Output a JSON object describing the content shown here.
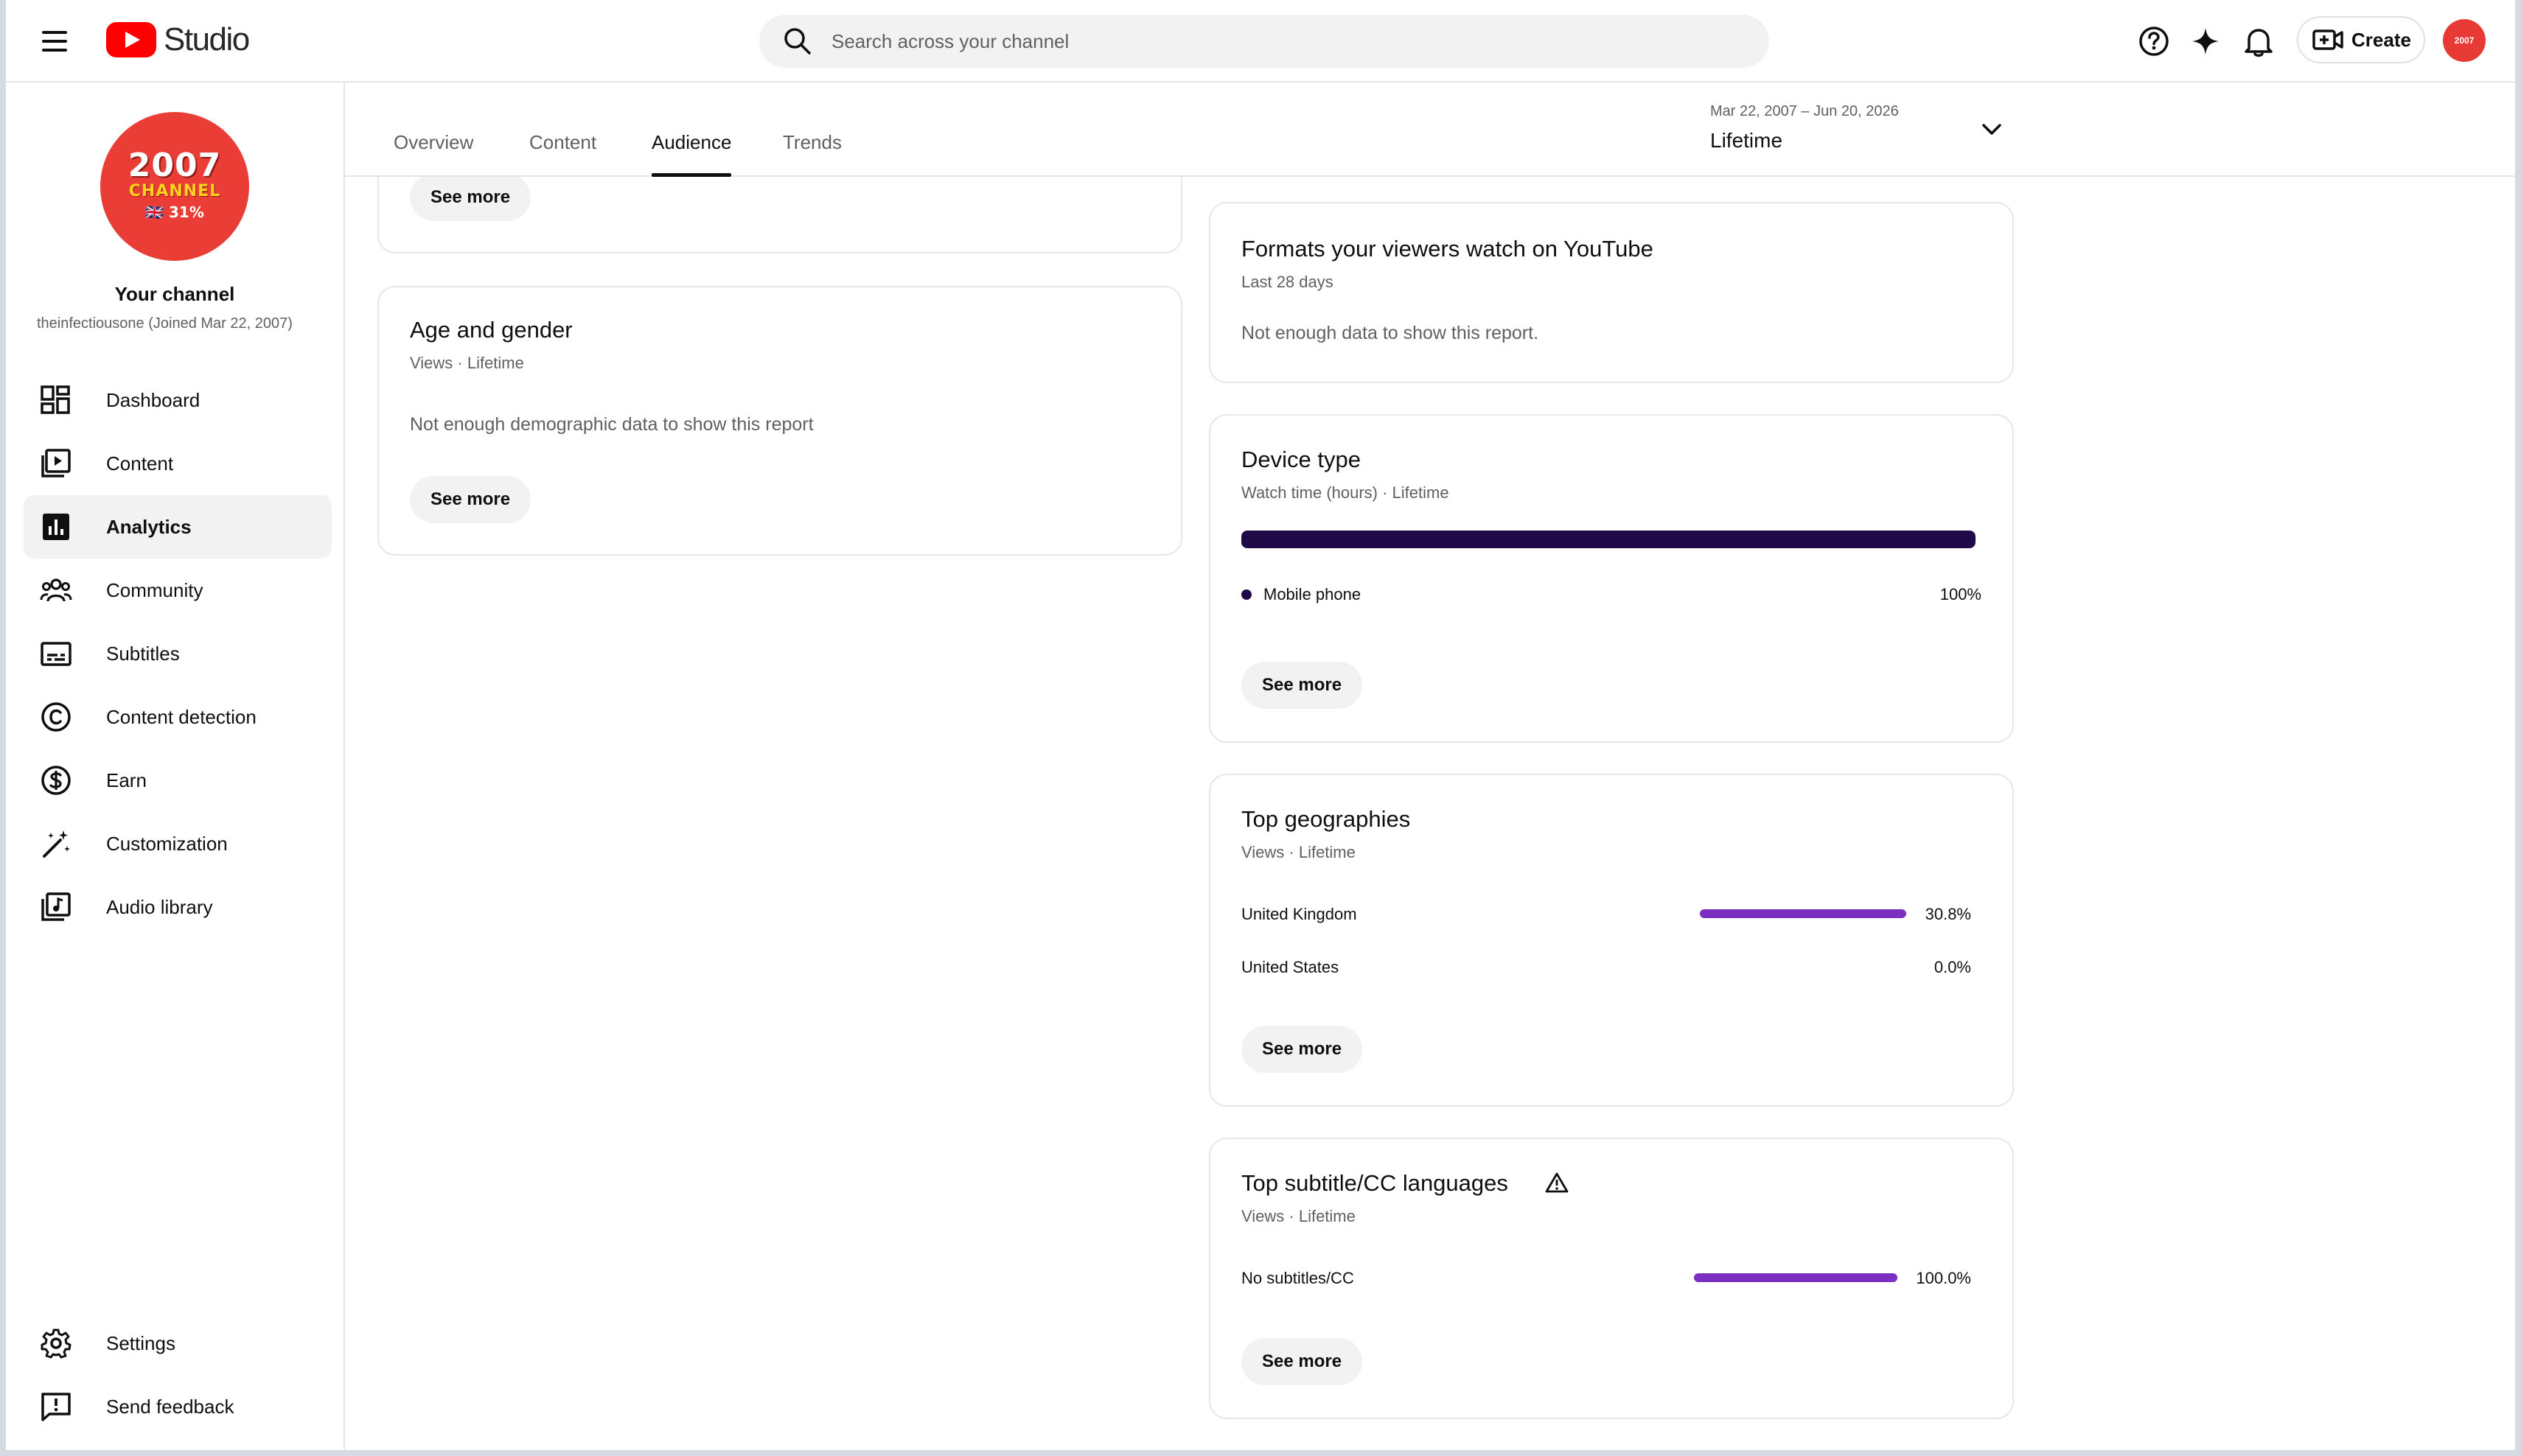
{
  "app": {
    "logo_text": "Studio",
    "search_placeholder": "Search across your channel",
    "create_label": "Create"
  },
  "channel": {
    "avatar_year": "2007",
    "avatar_word": "CHANNEL",
    "avatar_pct": "🇬🇧 31%",
    "name": "Your channel",
    "sub": "theinfectiousone (Joined Mar 22, 2007)"
  },
  "sidebar": {
    "items": [
      {
        "label": "Dashboard",
        "icon": "dashboard-icon"
      },
      {
        "label": "Content",
        "icon": "content-icon"
      },
      {
        "label": "Analytics",
        "icon": "analytics-icon",
        "active": true
      },
      {
        "label": "Community",
        "icon": "community-icon"
      },
      {
        "label": "Subtitles",
        "icon": "subtitles-icon"
      },
      {
        "label": "Content detection",
        "icon": "copyright-icon"
      },
      {
        "label": "Earn",
        "icon": "dollar-icon"
      },
      {
        "label": "Customization",
        "icon": "magic-wand-icon"
      },
      {
        "label": "Audio library",
        "icon": "audio-library-icon"
      }
    ],
    "bottom": [
      {
        "label": "Settings",
        "icon": "gear-icon"
      },
      {
        "label": "Send feedback",
        "icon": "feedback-icon"
      }
    ]
  },
  "tabs": [
    {
      "label": "Overview"
    },
    {
      "label": "Content"
    },
    {
      "label": "Audience",
      "active": true
    },
    {
      "label": "Trends"
    }
  ],
  "date_range": {
    "range": "Mar 22, 2007 – Jun 20, 2026",
    "label": "Lifetime"
  },
  "cards": {
    "top_partial": {
      "button": "See more"
    },
    "age_gender": {
      "title": "Age and gender",
      "sub": "Views · Lifetime",
      "message": "Not enough demographic data to show this report",
      "button": "See more"
    },
    "formats": {
      "title": "Formats your viewers watch on YouTube",
      "sub": "Last 28 days",
      "message": "Not enough data to show this report."
    },
    "device": {
      "title": "Device type",
      "sub": "Watch time (hours) · Lifetime",
      "rows": [
        {
          "label": "Mobile phone",
          "value": "100%",
          "fraction": 1.0
        }
      ],
      "button": "See more"
    },
    "geographies": {
      "title": "Top geographies",
      "sub": "Views · Lifetime",
      "rows": [
        {
          "label": "United Kingdom",
          "value": "30.8%",
          "fraction": 1.0
        },
        {
          "label": "United States",
          "value": "0.0%",
          "fraction": 0.0
        }
      ],
      "button": "See more"
    },
    "subtitles": {
      "title": "Top subtitle/CC languages",
      "sub": "Views · Lifetime",
      "rows": [
        {
          "label": "No subtitles/CC",
          "value": "100.0%",
          "fraction": 1.0
        }
      ],
      "button": "See more"
    }
  },
  "colors": {
    "accent_purple": "#7b2fc0",
    "device_bar": "#1f0a47",
    "brand_red": "#ff0000"
  }
}
